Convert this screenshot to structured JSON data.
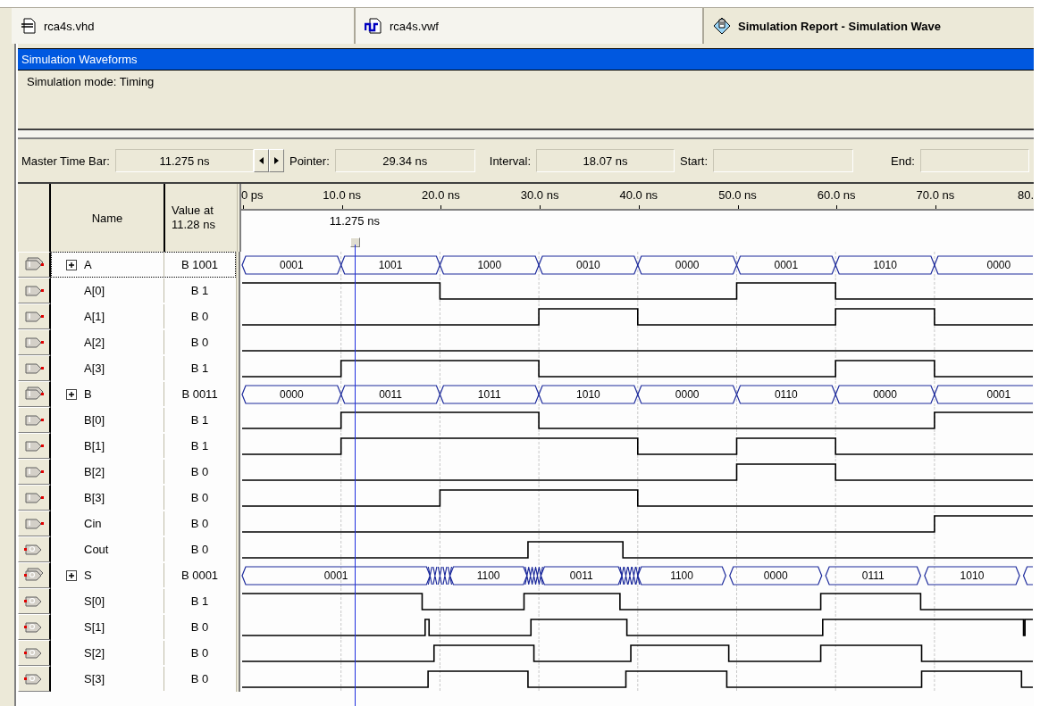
{
  "tabs": [
    {
      "label": "rca4s.vhd",
      "selected": false
    },
    {
      "label": "rca4s.vwf",
      "selected": false
    },
    {
      "label": "Simulation Report - Simulation Wave",
      "selected": true
    }
  ],
  "panel": {
    "title": "Simulation Waveforms",
    "mode": "Simulation mode: Timing"
  },
  "time_bar": {
    "master_label": "Master Time Bar:",
    "master_value": "11.275 ns",
    "pointer_label": "Pointer:",
    "pointer_value": "29.34 ns",
    "interval_label": "Interval:",
    "interval_value": "18.07 ns",
    "start_label": "Start:",
    "end_label": "End:"
  },
  "columns": {
    "name": "Name",
    "value": "Value at 11.28 ns"
  },
  "ruler": {
    "ticks": [
      "0 ps",
      "10.0 ns",
      "20.0 ns",
      "30.0 ns",
      "40.0 ns",
      "50.0 ns",
      "60.0 ns",
      "70.0 ns",
      "80."
    ],
    "cursor_label": "11.275 ns"
  },
  "signals": [
    {
      "name": "A",
      "value": "B 1001",
      "kind": "input",
      "expanded": false,
      "selected": true,
      "segments": [
        "0001",
        "1001",
        "1000",
        "0010",
        "0000",
        "0001",
        "1010",
        "0000"
      ]
    },
    {
      "name": "A[0]",
      "value": "B 1",
      "kind": "input",
      "selected": false
    },
    {
      "name": "A[1]",
      "value": "B 0",
      "kind": "input",
      "selected": false
    },
    {
      "name": "A[2]",
      "value": "B 0",
      "kind": "input",
      "selected": false
    },
    {
      "name": "A[3]",
      "value": "B 1",
      "kind": "input",
      "selected": false
    },
    {
      "name": "B",
      "value": "B 0011",
      "kind": "input",
      "expanded": false,
      "selected": false,
      "segments": [
        "0000",
        "0011",
        "1011",
        "1010",
        "0000",
        "0110",
        "0000",
        "0001"
      ]
    },
    {
      "name": "B[0]",
      "value": "B 1",
      "kind": "input",
      "selected": false
    },
    {
      "name": "B[1]",
      "value": "B 1",
      "kind": "input",
      "selected": false
    },
    {
      "name": "B[2]",
      "value": "B 0",
      "kind": "input",
      "selected": false
    },
    {
      "name": "B[3]",
      "value": "B 0",
      "kind": "input",
      "selected": false
    },
    {
      "name": "Cin",
      "value": "B 0",
      "kind": "input",
      "selected": false
    },
    {
      "name": "Cout",
      "value": "B 0",
      "kind": "output",
      "selected": false
    },
    {
      "name": "S",
      "value": "B 0001",
      "kind": "output",
      "expanded": false,
      "selected": false,
      "segments": [
        "0001",
        "1100",
        "0011",
        "1100",
        "0000",
        "0111",
        "1010"
      ]
    },
    {
      "name": "S[0]",
      "value": "B 1",
      "kind": "output",
      "selected": false
    },
    {
      "name": "S[1]",
      "value": "B 0",
      "kind": "output",
      "selected": false
    },
    {
      "name": "S[2]",
      "value": "B 0",
      "kind": "output",
      "selected": false
    },
    {
      "name": "S[3]",
      "value": "B 0",
      "kind": "output",
      "selected": false
    }
  ]
}
